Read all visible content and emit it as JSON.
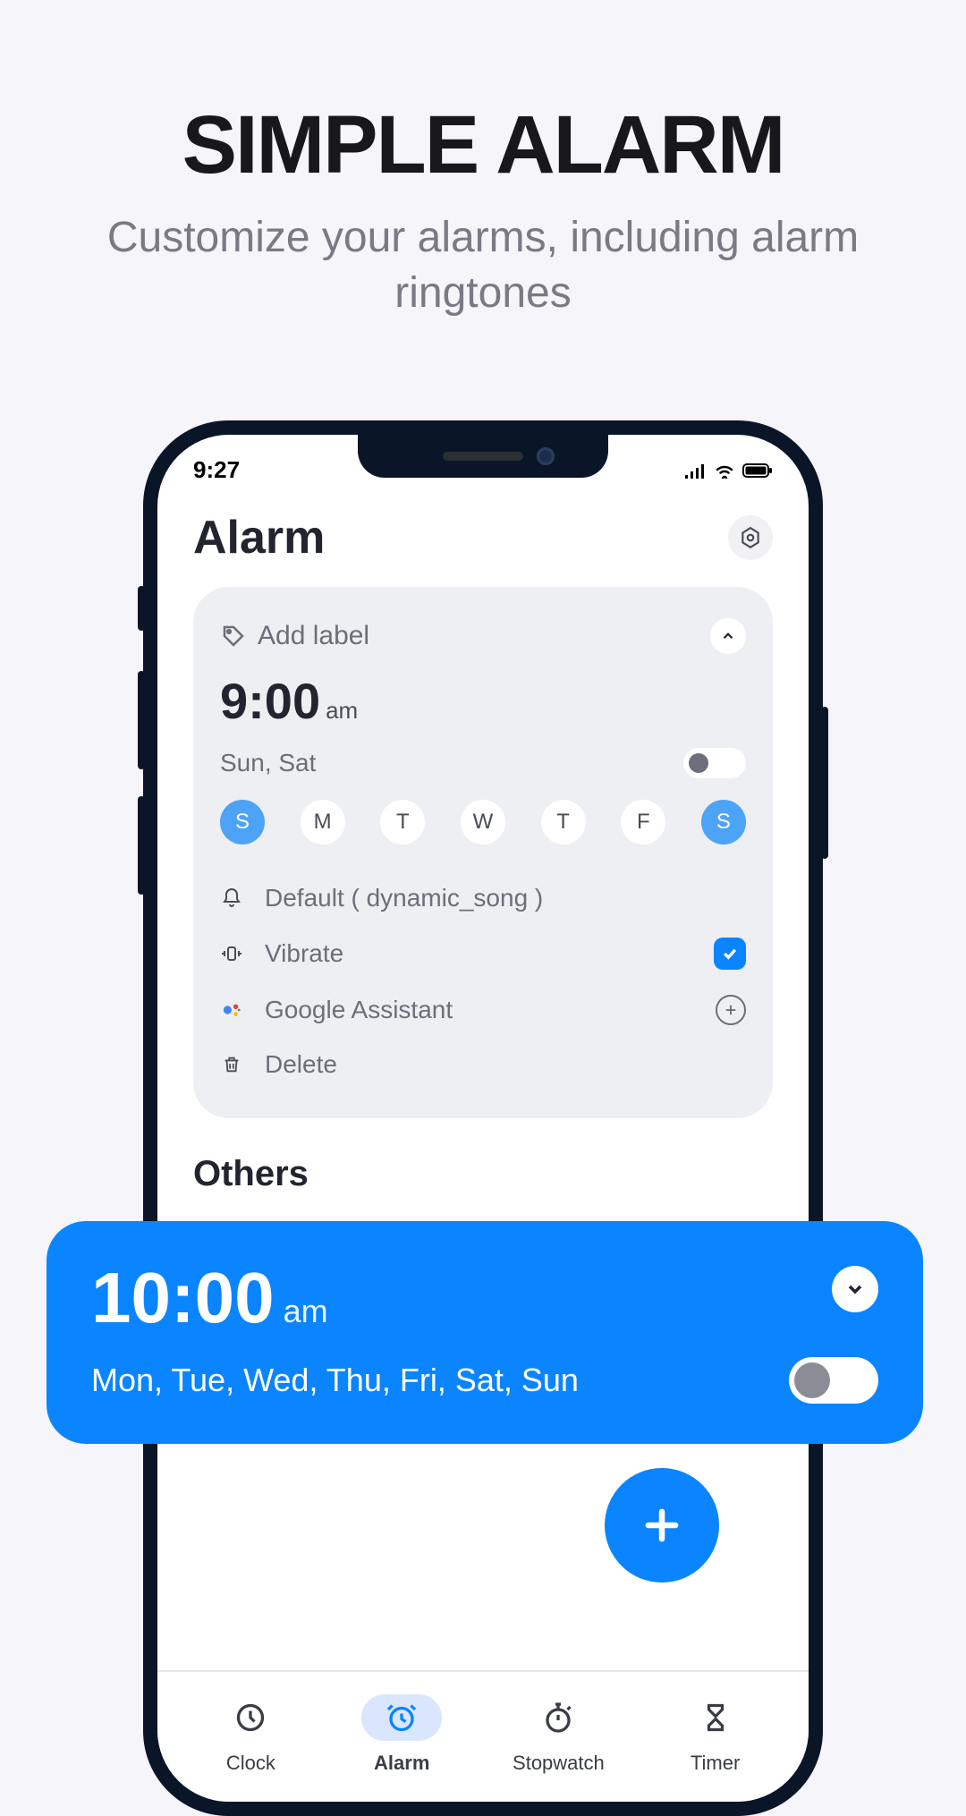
{
  "marketing": {
    "title": "SIMPLE ALARM",
    "subtitle": "Customize your alarms, including alarm ringtones"
  },
  "status": {
    "time": "9:27"
  },
  "header": {
    "title": "Alarm"
  },
  "alarm_card": {
    "add_label": "Add label",
    "time": "9:00",
    "ampm": "am",
    "days_summary": "Sun, Sat",
    "days": [
      {
        "letter": "S",
        "on": true
      },
      {
        "letter": "M",
        "on": false
      },
      {
        "letter": "T",
        "on": false
      },
      {
        "letter": "W",
        "on": false
      },
      {
        "letter": "T",
        "on": false
      },
      {
        "letter": "F",
        "on": false
      },
      {
        "letter": "S",
        "on": true
      }
    ],
    "ringtone": "Default ( dynamic_song )",
    "vibrate": "Vibrate",
    "assistant": "Google Assistant",
    "delete": "Delete"
  },
  "others_heading": "Others",
  "blue_card": {
    "time": "10:00",
    "ampm": "am",
    "days": "Mon, Tue, Wed, Thu, Fri, Sat, Sun"
  },
  "nav": {
    "clock": "Clock",
    "alarm": "Alarm",
    "stopwatch": "Stopwatch",
    "timer": "Timer"
  }
}
